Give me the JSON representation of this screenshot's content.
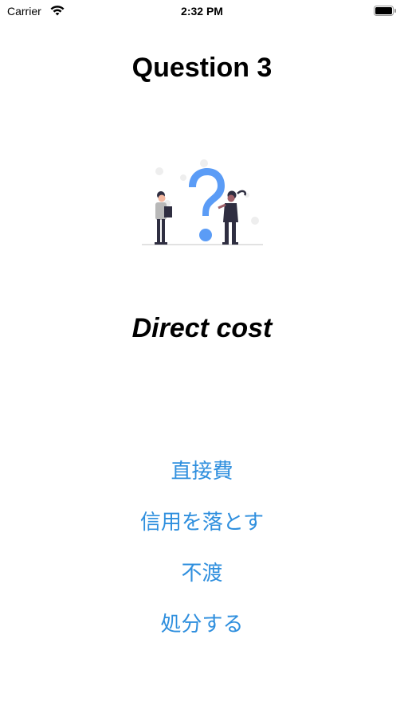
{
  "status_bar": {
    "carrier": "Carrier",
    "time": "2:32 PM",
    "wifi_icon": "wifi-icon",
    "battery_icon": "battery-icon"
  },
  "quiz": {
    "title": "Question 3",
    "illustration": "question-illustration",
    "term": "Direct cost",
    "answers": [
      {
        "label": "直接費"
      },
      {
        "label": "信用を落とす"
      },
      {
        "label": "不渡"
      },
      {
        "label": "処分する"
      }
    ]
  },
  "colors": {
    "accent": "#2f8fde",
    "question_mark": "#5b9cf6",
    "figure_dark": "#2f2e41"
  }
}
